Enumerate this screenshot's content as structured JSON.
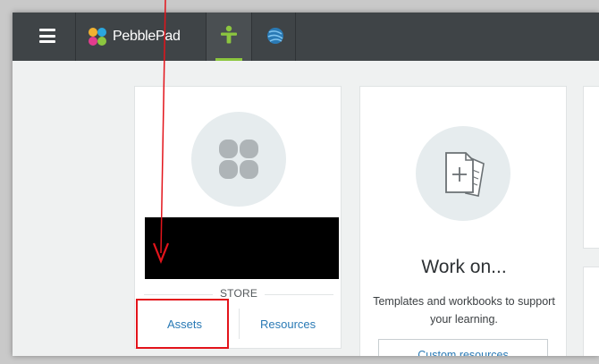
{
  "header": {
    "brand": "PebblePad",
    "menu_icon": "hamburger-menu-icon",
    "tabs": [
      {
        "icon": "person-icon",
        "active": true
      },
      {
        "icon": "globe-icon",
        "active": false
      }
    ]
  },
  "store_card": {
    "section_label": "STORE",
    "links": [
      "Assets",
      "Resources"
    ]
  },
  "work_card": {
    "title": "Work on...",
    "description": "Templates and workbooks to support your learning.",
    "button_label": "Custom resources"
  },
  "colors": {
    "topbar": "#3f4447",
    "accent_green": "#8cc63f",
    "link_blue": "#2a7ab5",
    "annotation_red": "#e3141b"
  }
}
